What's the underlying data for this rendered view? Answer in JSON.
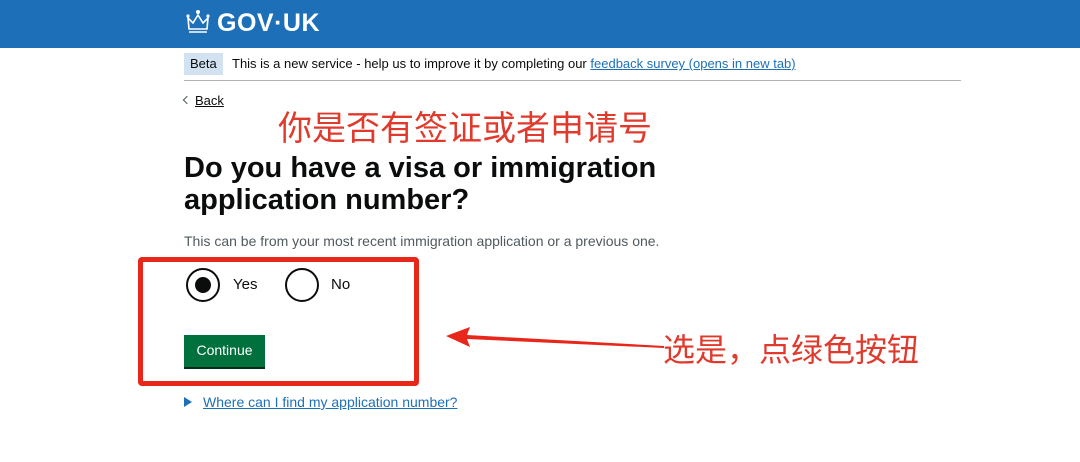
{
  "colors": {
    "header_bg": "#1d70b8",
    "link": "#1d70b8",
    "button_bg": "#00703c",
    "annotation_red": "#e8271b",
    "beta_tag_bg": "#d2e2f1"
  },
  "header": {
    "logo_text": "GOV·UK",
    "logo_icon": "crown-icon"
  },
  "phase_banner": {
    "tag": "Beta",
    "text": "This is a new service - help us to improve it by completing our",
    "link": "feedback survey (opens in new tab)"
  },
  "back_link": "Back",
  "annotations": {
    "title": "你是否有签证或者申请号",
    "instruction": "选是，点绿色按钮"
  },
  "question": {
    "heading": "Do you have a visa or immigration application number?",
    "hint": "This can be from your most recent immigration application or a previous one.",
    "options": [
      {
        "label": "Yes",
        "selected": true
      },
      {
        "label": "No",
        "selected": false
      }
    ]
  },
  "continue_button": "Continue",
  "details": {
    "summary": "Where can I find my application number?"
  }
}
